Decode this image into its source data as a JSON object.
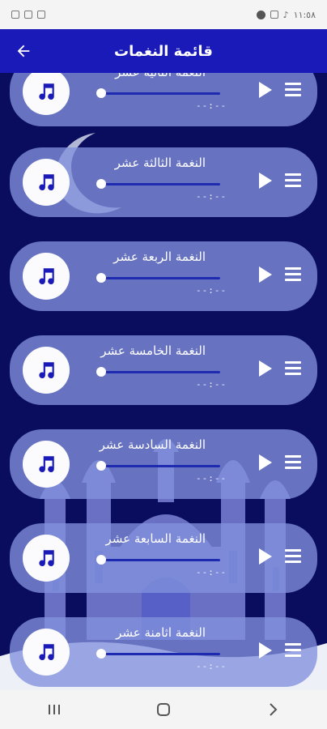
{
  "status_bar": {
    "time": "١١:٥٨"
  },
  "app_bar": {
    "title": "قائمة النغمات"
  },
  "tracks": [
    {
      "title": "النغمة الثانية عشر",
      "time": "--:--"
    },
    {
      "title": "النغمة الثالثة عشر",
      "time": "--:--"
    },
    {
      "title": "النغمة الربعة عشر",
      "time": "--:--"
    },
    {
      "title": "النغمة الخامسة عشر",
      "time": "--:--"
    },
    {
      "title": "النغمة السادسة عشر",
      "time": "--:--"
    },
    {
      "title": "النغمة السابعة عشر",
      "time": "--:--"
    },
    {
      "title": "النغمة اثامنة عشر",
      "time": "--:--"
    }
  ],
  "icons": {
    "back": "arrow-left-icon",
    "disc": "music-note-icon",
    "play": "play-icon",
    "menu": "hamburger-icon",
    "nav": [
      "recent-apps-icon",
      "home-icon",
      "back-icon"
    ]
  },
  "colors": {
    "app_bar": "#1a1ab8",
    "background": "#0a0d5e",
    "card": "#8291dc",
    "progress": "#1e2bb0"
  }
}
